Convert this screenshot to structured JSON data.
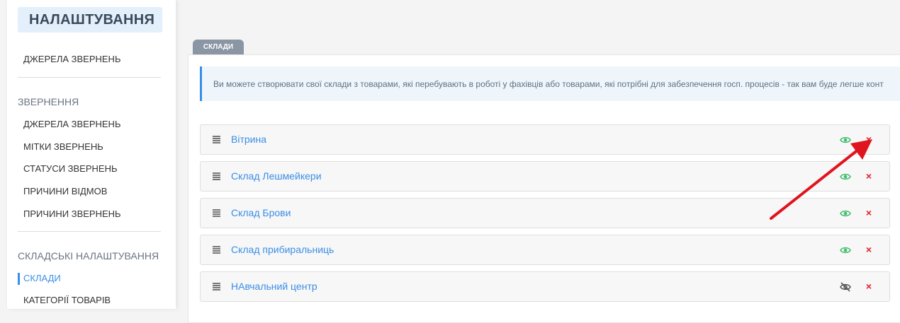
{
  "sidebar": {
    "title": "НАЛАШТУВАННЯ",
    "top_item": "ДЖЕРЕЛА ЗВЕРНЕНЬ",
    "sections": [
      {
        "heading": "ЗВЕРНЕННЯ",
        "items": [
          "ДЖЕРЕЛА ЗВЕРНЕНЬ",
          "МІТКИ ЗВЕРНЕНЬ",
          "СТАТУСИ ЗВЕРНЕНЬ",
          "ПРИЧИНИ ВІДМОВ",
          "ПРИЧИНИ ЗВЕРНЕНЬ"
        ]
      },
      {
        "heading": "СКЛАДСЬКІ НАЛАШТУВАННЯ",
        "items": [
          "СКЛАДИ",
          "КАТЕГОРІЇ ТОВАРІВ"
        ],
        "active": "СКЛАДИ"
      }
    ]
  },
  "main": {
    "tab": "СКЛАДИ",
    "info": "Ви можете створювати свої склади з товарами, які перебувають в роботі у фахівців або товарами, які потрібні для забезпечення госп. процесів - так вам буде легше конт",
    "warehouses": [
      {
        "name": "Вітрина",
        "visible": true
      },
      {
        "name": "Склад Лешмейкери",
        "visible": true
      },
      {
        "name": "Склад Брови",
        "visible": true
      },
      {
        "name": "Склад прибиральниць",
        "visible": true
      },
      {
        "name": "НАвчальний центр",
        "visible": false
      }
    ],
    "delete_glyph": "×"
  },
  "colors": {
    "accent": "#3a8ee6",
    "delete": "#e0212a",
    "visible_eye": "#3cbf6a",
    "hidden_eye": "#555555",
    "annotation_arrow": "#e0141e"
  }
}
